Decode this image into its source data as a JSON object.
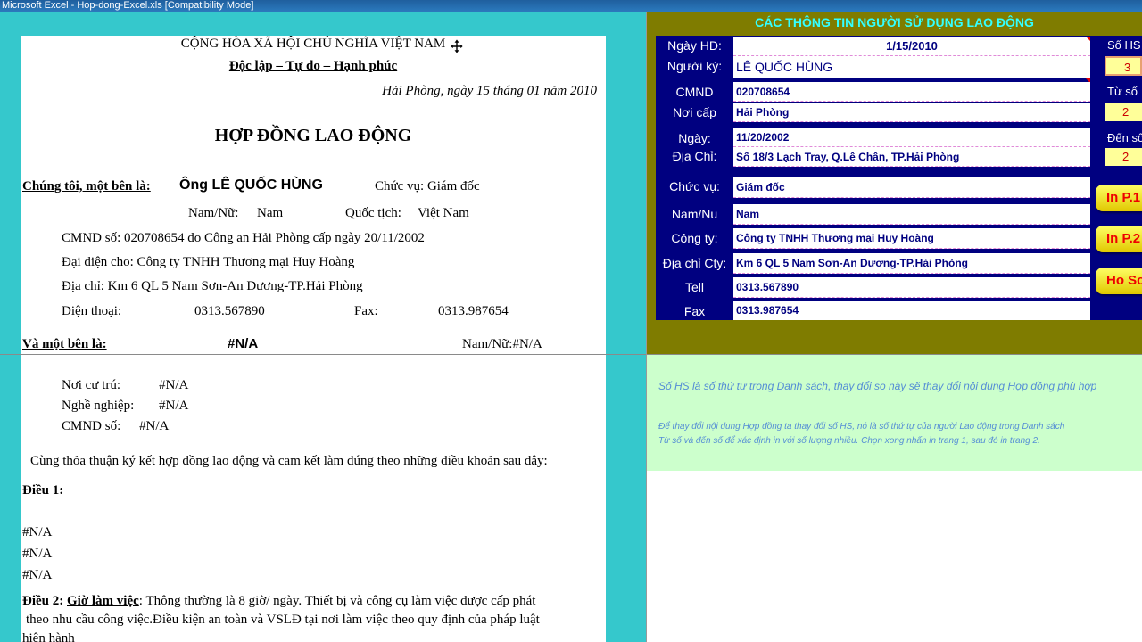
{
  "window": {
    "title": "Microsoft Excel - Hop-dong-Excel.xls  [Compatibility Mode]"
  },
  "document": {
    "motto_1": "CỘNG HÒA XÃ HỘI CHỦ NGHĨA VIỆT NAM",
    "motto_2": "Độc lập – Tự do – Hạnh phúc",
    "place_date": "Hải Phòng, ngày  15  tháng  01  năm  2010",
    "title": "HỢP ĐỒNG LAO ĐỘNG",
    "party_a_label": "Chúng tôi, một bên là:",
    "party_a_name": "Ông LÊ QUỐC HÙNG",
    "party_a_position": "Chức vụ: Giám đốc",
    "gender_label": "Nam/Nữ:",
    "gender_value": "Nam",
    "nationality_label": "Quốc tịch:",
    "nationality_value": "Việt Nam",
    "id_line": "CMND số:   020708654 do Công an Hải Phòng cấp ngày 20/11/2002",
    "rep_line": "Đại diện cho:   Công ty TNHH Thương mại Huy Hoàng",
    "addr_line": "Địa chỉ:    Km 6 QL 5 Nam Sơn-An Dương-TP.Hải Phòng",
    "phone_label": "Diện thoại:",
    "phone_value": "0313.567890",
    "fax_label": "Fax:",
    "fax_value": "0313.987654",
    "party_b_label": "Và một bên là:",
    "party_b_name": "#N/A",
    "party_b_gender": "Nam/Nữ:#N/A",
    "residence_label": "Nơi cư trú:",
    "residence_value": "#N/A",
    "job_label": "Nghề nghiệp:",
    "job_value": "#N/A",
    "cmnd_label": "CMND số:",
    "cmnd_value": "#N/A",
    "agreement": "Cùng thỏa thuận ký kết hợp đồng lao động và cam kết làm đúng theo những điều khoản sau đây:",
    "article1": "Điều 1:",
    "na1": "#N/A",
    "na2": "#N/A",
    "na3": "#N/A",
    "article2_label": "Điều 2:",
    "article2_title": "Giờ làm việc",
    "article2_text1": ":  Thông thường là 8 giờ/ ngày. Thiết bị và công cụ làm việc được cấp phát",
    "article2_text2": "theo nhu cầu công việc.Điều kiện an toàn và VSLĐ tại nơi làm việc theo quy định của pháp luật",
    "article2_text3": "hiện hành"
  },
  "panel": {
    "title": "CÁC THÔNG TIN NGƯỜI SỬ DỤNG LAO ĐỘNG",
    "fields": [
      {
        "label": "Ngày HD:",
        "value": "1/15/2010"
      },
      {
        "label": "Người ký:",
        "value": "LÊ QUỐC HÙNG"
      },
      {
        "label": "CMND",
        "value": "020708654"
      },
      {
        "label": "Nơi cấp",
        "value": "Hải Phòng"
      },
      {
        "label": "Ngày:",
        "value": "11/20/2002"
      },
      {
        "label": "Địa Chỉ:",
        "value": "Số 18/3 Lạch Tray, Q.Lê Chân, TP.Hải Phòng"
      },
      {
        "label": "Chức vụ:",
        "value": "Giám đốc"
      },
      {
        "label": "Nam/Nu",
        "value": "Nam"
      },
      {
        "label": "Công ty:",
        "value": "Công ty TNHH Thương mại Huy Hoàng"
      },
      {
        "label": "Địa chỉ Cty:",
        "value": "Km 6 QL 5 Nam Sơn-An Dương-TP.Hải Phòng"
      },
      {
        "label": "Tell",
        "value": "0313.567890"
      },
      {
        "label": "Fax",
        "value": "0313.987654"
      }
    ],
    "so_hs_label": "Số HS",
    "so_hs_value": "3",
    "tu_so_label": "Từ số",
    "tu_so_value": "2",
    "den_so_label": "Đến số",
    "den_so_value": "2",
    "btn_in_p1": "In P.1",
    "btn_in_p2": "In P.2",
    "btn_ho_so": "Ho Sơ"
  },
  "notes": {
    "note1": "Số HS là số thứ tự trong Danh sách, thay đổi so này sẽ thay đổi nội dung Hợp đồng phù hợp",
    "note2": "Để thay đổi nội dung Hợp đồng ta thay đổi số HS, nó là số thứ tự của người Lao động trong Danh sách",
    "note3": "Từ số và đến số để xác định in với số lượng nhiều. Chọn xong nhấn in trang 1, sau đó in trang 2."
  }
}
